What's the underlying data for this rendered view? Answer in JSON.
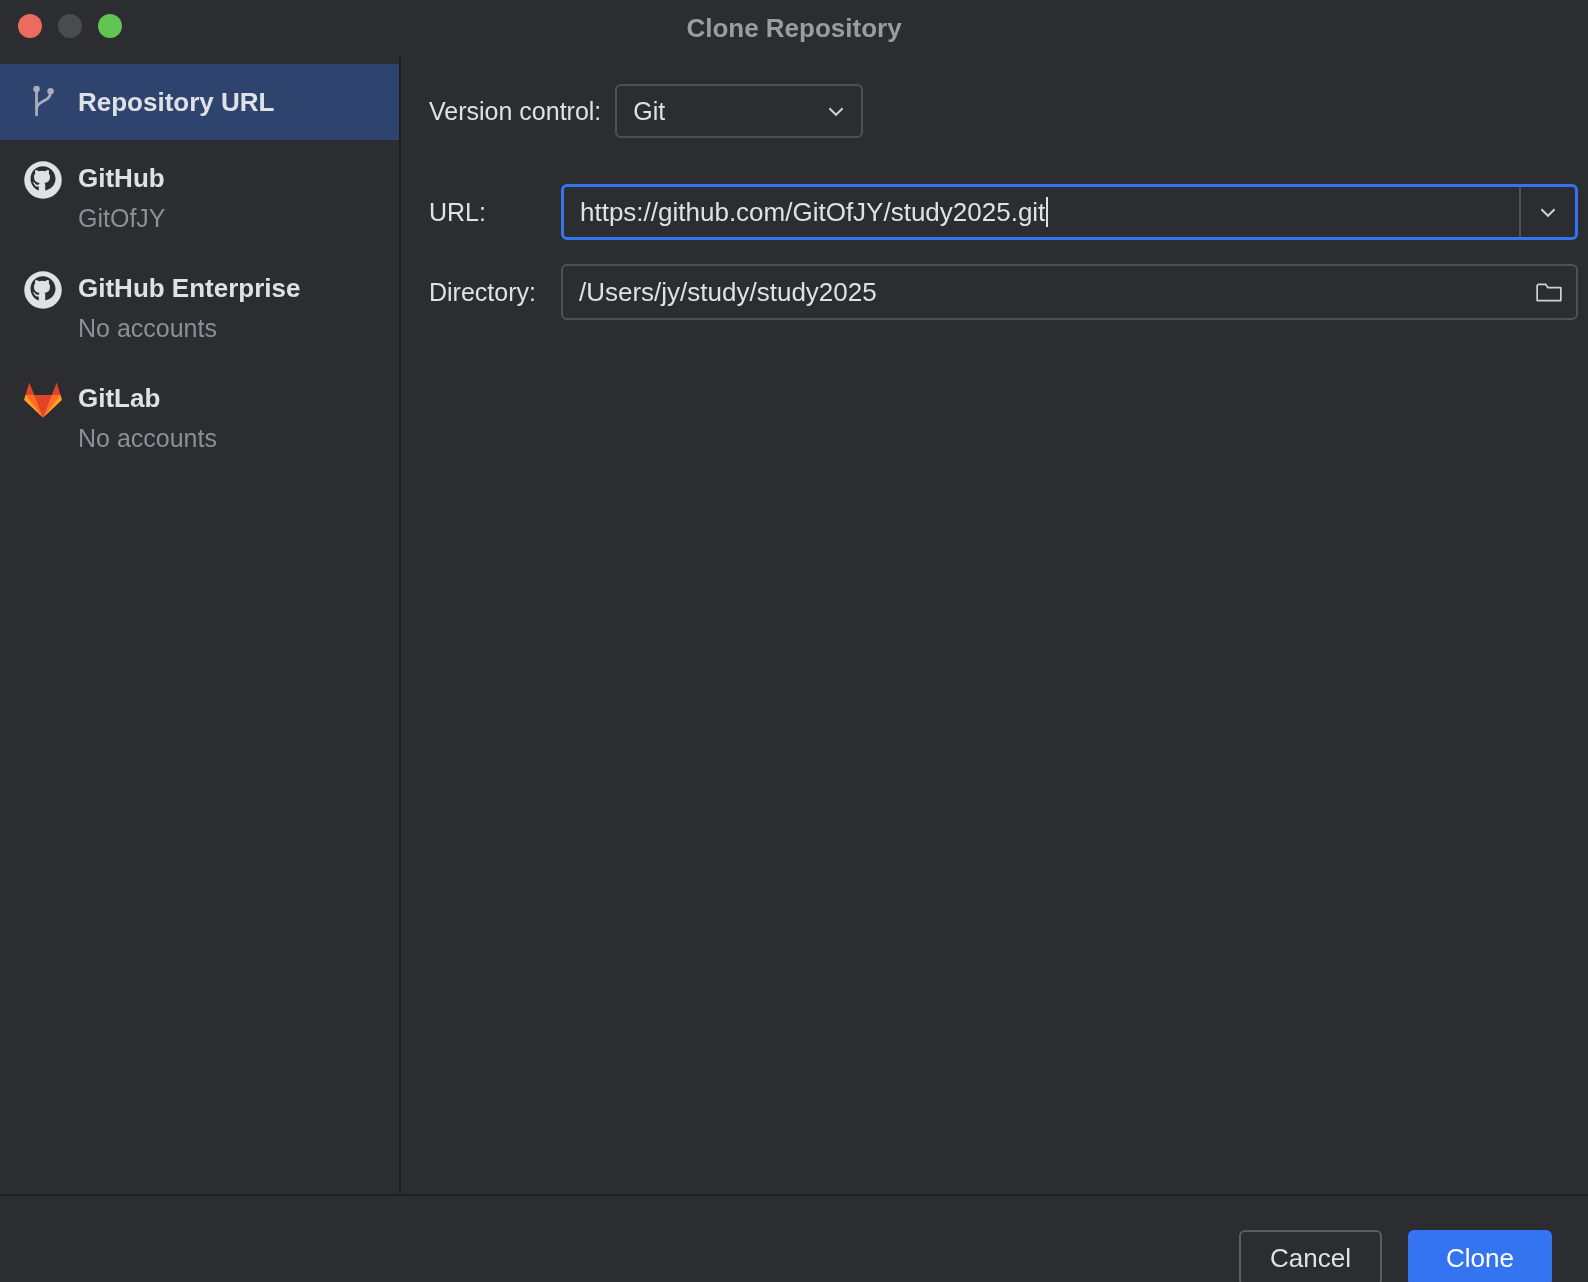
{
  "window": {
    "title": "Clone Repository"
  },
  "sidebar": {
    "items": [
      {
        "kind": "url",
        "label": "Repository URL",
        "selected": true
      },
      {
        "kind": "github",
        "label": "GitHub",
        "subtitle": "GitOfJY",
        "selected": false
      },
      {
        "kind": "github",
        "label": "GitHub Enterprise",
        "subtitle": "No accounts",
        "selected": false
      },
      {
        "kind": "gitlab",
        "label": "GitLab",
        "subtitle": "No accounts",
        "selected": false
      }
    ]
  },
  "form": {
    "version_control": {
      "label": "Version control:",
      "value": "Git"
    },
    "url": {
      "label": "URL:",
      "value": "https://github.com/GitOfJY/study2025.git",
      "focused": true
    },
    "directory": {
      "label": "Directory:",
      "value": "/Users/jy/study/study2025",
      "focused": false
    }
  },
  "buttons": [
    {
      "label": "Cancel",
      "kind": "secondary"
    },
    {
      "label": "Clone",
      "kind": "primary"
    }
  ]
}
